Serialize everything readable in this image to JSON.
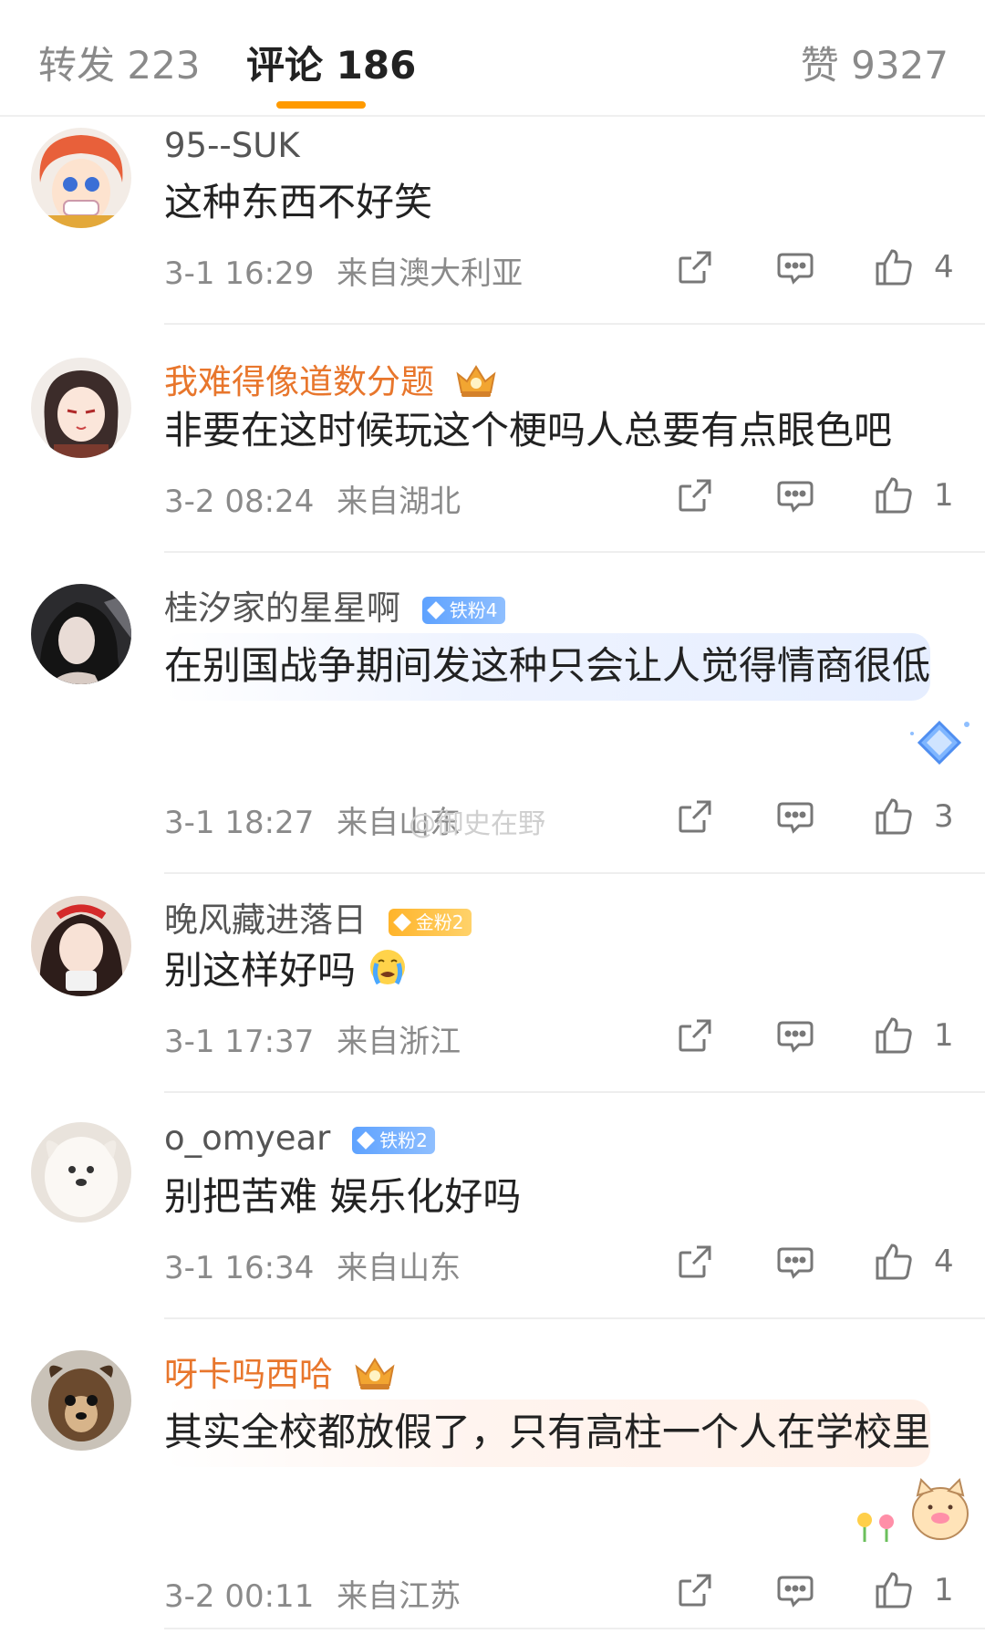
{
  "tabs": {
    "repost": "转发 223",
    "comment": "评论 186",
    "like": "赞 9327",
    "active_color": "#ff9a00"
  },
  "comments": [
    {
      "username": "95--SUK",
      "text": "这种东西不好笑",
      "time": "3-1 16:29",
      "location": "来自澳大利亚",
      "likes": "4"
    },
    {
      "username": "我难得像道数分题",
      "crown": true,
      "text": "非要在这时候玩这个梗吗人总要有点眼色吧",
      "time": "3-2 08:24",
      "location": "来自湖北",
      "likes": "1"
    },
    {
      "username": "桂汐家的星星啊",
      "badge": "铁粉4",
      "text": "在别国战争期间发这种只会让人觉得情商很低",
      "time": "3-1 18:27",
      "location": "来自山东",
      "likes": "3"
    },
    {
      "username": "晚风藏进落日",
      "badge": "金粉2",
      "text": "别这样好吗",
      "emoji": "crying-emoji",
      "time": "3-1 17:37",
      "location": "来自浙江",
      "likes": "1"
    },
    {
      "username": "o_omyear",
      "badge": "铁粉2",
      "text": "别把苦难 娱乐化好吗",
      "time": "3-1 16:34",
      "location": "来自山东",
      "likes": "4"
    },
    {
      "username": "呀卡吗西哈",
      "crown": true,
      "text": "其实全校都放假了，只有高柱一个人在学校里",
      "time": "3-2 00:11",
      "location": "来自江苏",
      "likes": "1"
    }
  ],
  "watermark": "@御史在野",
  "colors": {
    "vip_name": "#e8762c",
    "iron_badge": "#5ea2ff",
    "gold_badge": "#ffb42a"
  }
}
